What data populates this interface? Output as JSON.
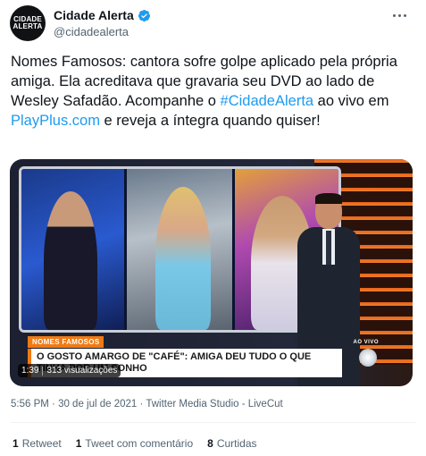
{
  "header": {
    "display_name": "Cidade Alerta",
    "handle": "@cidadealerta",
    "avatar_text": "CIDADE ALERTA"
  },
  "tweet": {
    "text_before": "Nomes Famosos: cantora sofre golpe aplicado pela própria amiga. Ela acreditava que gravaria seu DVD ao lado de Wesley Safadão. Acompanhe o ",
    "hashtag": "#CidadeAlerta",
    "text_middle": " ao vivo em ",
    "link": "PlayPlus.com",
    "text_after": " e reveja a íntegra quando quiser!"
  },
  "media": {
    "lower_third_tag": "NOMES FAMOSOS",
    "lower_third_headline": "O GOSTO AMARGO DE \"CAFÉ\": AMIGA DEU TUDO O QUE TINHA POR UM SONHO",
    "live_label": "AO VIVO",
    "duration": "1:39",
    "views": "313 visualizações"
  },
  "meta": {
    "time": "5:56 PM",
    "date": "30 de jul de 2021",
    "source": "Twitter Media Studio - LiveCut",
    "separator": " · "
  },
  "stats": {
    "retweets_count": "1",
    "retweets_label": "Retweet",
    "quotes_count": "1",
    "quotes_label": "Tweet com comentário",
    "likes_count": "8",
    "likes_label": "Curtidas"
  },
  "colors": {
    "link": "#1d9bf0",
    "text": "#0f1419",
    "muted": "#536471",
    "accent_orange": "#f07a14"
  },
  "icons": [
    "verified-badge-icon",
    "more-options-icon",
    "tv-logo-icon"
  ]
}
